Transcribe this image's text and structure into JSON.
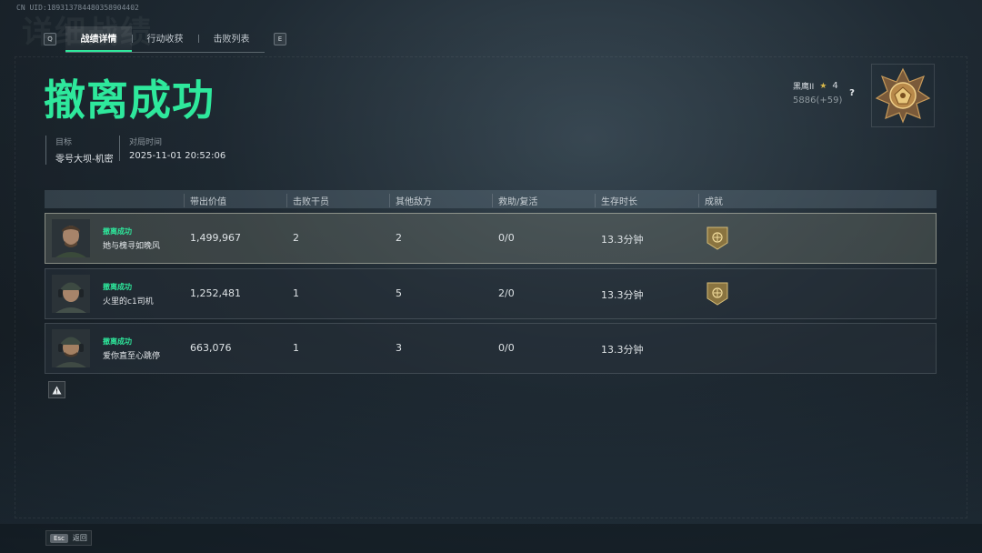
{
  "uid": "CN UID:189313784480358904402",
  "bg_title": "详细战绩",
  "tabs": {
    "left_key": "Q",
    "right_key": "E",
    "items": [
      {
        "label": "战绩详情",
        "active": true
      },
      {
        "label": "行动收获",
        "active": false
      },
      {
        "label": "击败列表",
        "active": false
      }
    ]
  },
  "result_title": "撤离成功",
  "meta": {
    "target_label": "目标",
    "target_value": "零号大坝-机密",
    "time_label": "对局时间",
    "time_value": "2025-11-01 20:52:06"
  },
  "rank": {
    "name": "黑鹰II",
    "stars": "4",
    "score": "5886(+59)",
    "help": "?"
  },
  "table": {
    "headers": [
      "带出价值",
      "击败干员",
      "其他敌方",
      "救助/复活",
      "生存时长",
      "成就"
    ],
    "rows": [
      {
        "status": "撤离成功",
        "name": "她与槐寻如晚风",
        "value": "1,499,967",
        "kills": "2",
        "other": "2",
        "assist": "0/0",
        "time": "13.3分钟",
        "achievement": true,
        "highlight": true
      },
      {
        "status": "撤离成功",
        "name": "火里的c1司机",
        "value": "1,252,481",
        "kills": "1",
        "other": "5",
        "assist": "2/0",
        "time": "13.3分钟",
        "achievement": true,
        "highlight": false
      },
      {
        "status": "撤离成功",
        "name": "爱你直至心跳停",
        "value": "663,076",
        "kills": "1",
        "other": "3",
        "assist": "0/0",
        "time": "13.3分钟",
        "achievement": false,
        "highlight": false
      }
    ]
  },
  "footer": {
    "esc_key": "Esc",
    "back_label": "返回"
  },
  "colors": {
    "accent": "#2ee89c",
    "gold": "#c9a24a"
  }
}
